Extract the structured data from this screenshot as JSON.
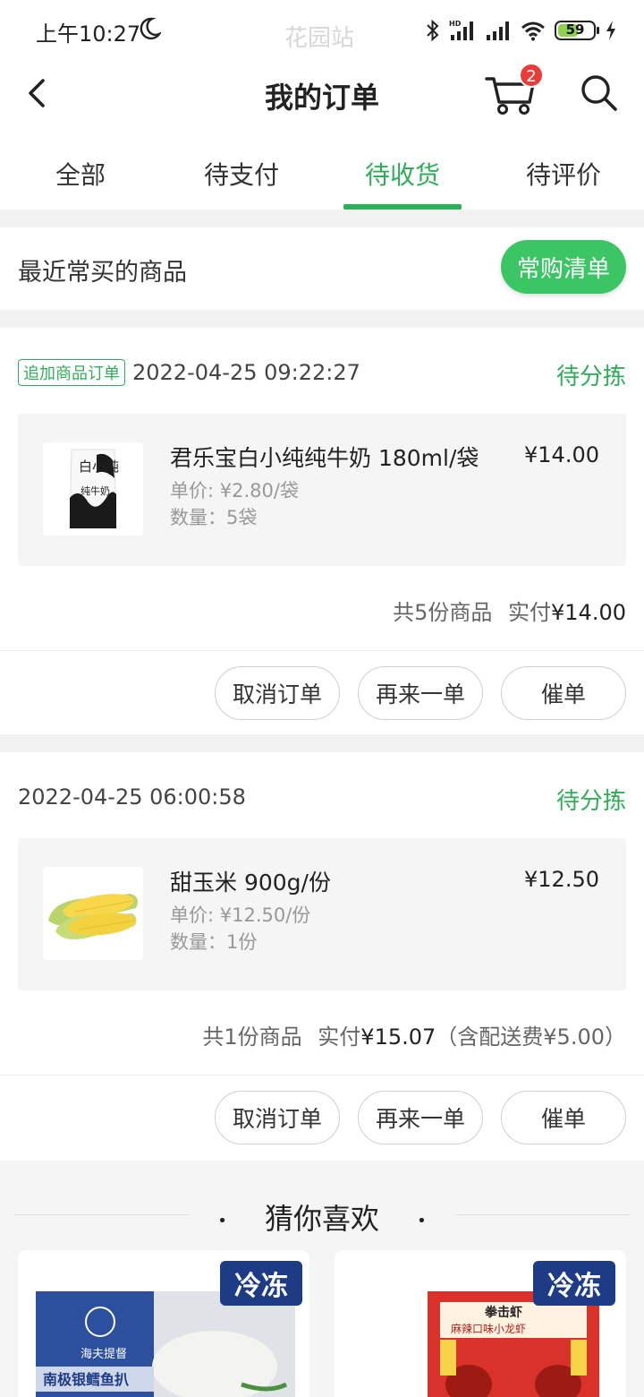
{
  "status_bar": {
    "time": "上午10:27",
    "watermark": "花园站",
    "battery": "59",
    "battery_level": 0.59
  },
  "nav": {
    "title": "我的订单",
    "cart_badge": "2"
  },
  "tabs": [
    {
      "label": "全部",
      "active": false
    },
    {
      "label": "待支付",
      "active": false
    },
    {
      "label": "待收货",
      "active": true
    },
    {
      "label": "待评价",
      "active": false
    }
  ],
  "frequent": {
    "label": "最近常买的商品",
    "button": "常购清单"
  },
  "orders": [
    {
      "tag": "追加商品订单",
      "time": "2022-04-25 09:22:27",
      "status": "待分拣",
      "item": {
        "name": "君乐宝白小纯纯牛奶 180ml/袋",
        "price": "¥14.00",
        "unit_price": "单价: ¥2.80/袋",
        "quantity": "数量：5袋",
        "image_text_1": "白小纯",
        "image_text_2": "纯牛奶"
      },
      "summary_count": "共5份商品",
      "summary_paid_label": "实付",
      "summary_paid": "¥14.00",
      "summary_extra": "",
      "actions": [
        "取消订单",
        "再来一单",
        "催单"
      ]
    },
    {
      "tag": "",
      "time": "2022-04-25 06:00:58",
      "status": "待分拣",
      "item": {
        "name": "甜玉米 900g/份",
        "price": "¥12.50",
        "unit_price": "单价: ¥12.50/份",
        "quantity": "数量：1份"
      },
      "summary_count": "共1份商品",
      "summary_paid_label": "实付",
      "summary_paid": "¥15.07",
      "summary_extra": "（含配送费¥5.00）",
      "actions": [
        "取消订单",
        "再来一单",
        "催单"
      ]
    }
  ],
  "recommend": {
    "title": "猜你喜欢",
    "items": [
      {
        "badge": "冷冻",
        "brand": "海夫提督",
        "product": "南极银鳕鱼扒"
      },
      {
        "badge": "冷冻",
        "brand": "拳击虾",
        "product": "麻辣口味小龙虾"
      }
    ]
  },
  "colors": {
    "accent": "#2fae58",
    "button_green": "#3cc565",
    "badge_red": "#ea3b3b",
    "frozen_badge": "#1e3c86"
  }
}
